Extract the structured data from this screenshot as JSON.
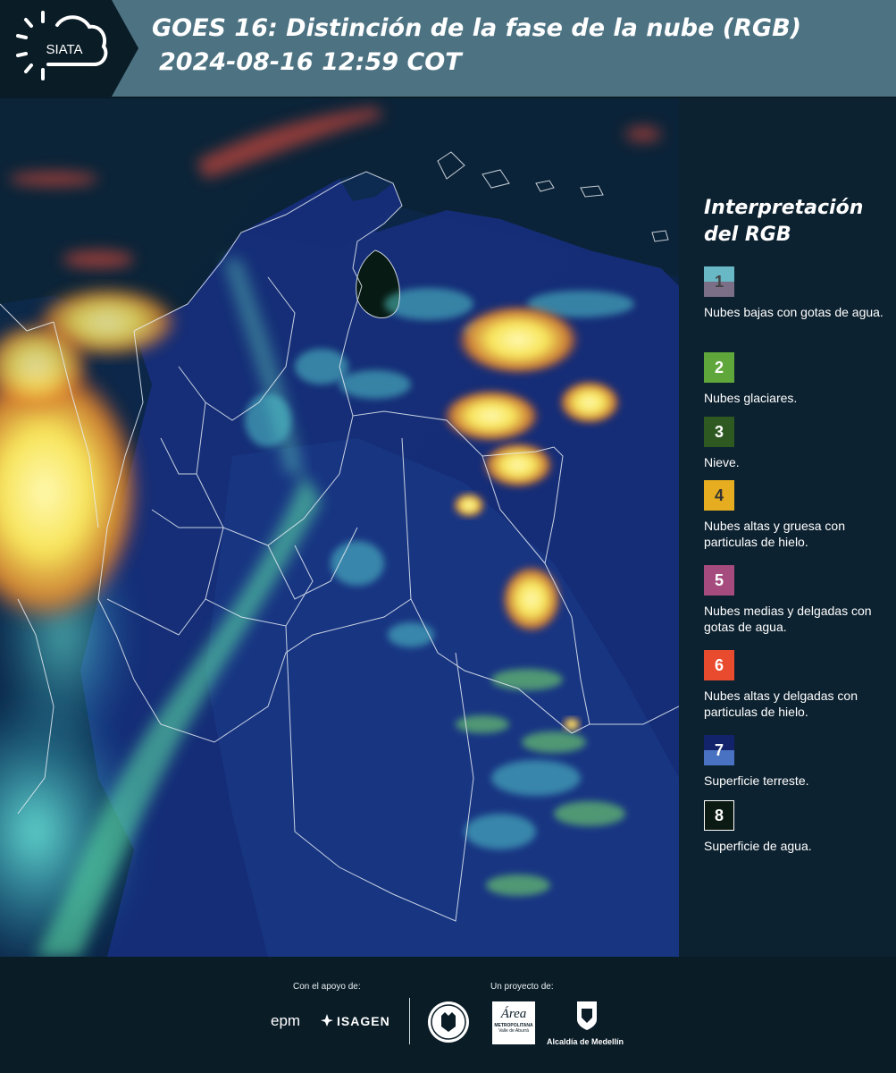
{
  "header": {
    "logo_text": "SIATA",
    "title_line1": "GOES 16: Distinción de la fase de la nube (RGB)",
    "title_line2": "2024-08-16 12:59 COT"
  },
  "legend": {
    "title": "Interpretación del RGB",
    "items": [
      {
        "number": "1",
        "label": "Nubes bajas con gotas de agua.",
        "color_top": "#68b8c6",
        "color_bottom": "#7a6f86",
        "text_color": "#444444"
      },
      {
        "number": "2",
        "label": "Nubes glaciares.",
        "color_top": "#5fa73a",
        "color_bottom": "#5fa73a",
        "text_color": "#ffffff"
      },
      {
        "number": "3",
        "label": "Nieve.",
        "color_top": "#2e5a22",
        "color_bottom": "#2e5a22",
        "text_color": "#ffffff"
      },
      {
        "number": "4",
        "label": "Nubes altas y gruesa con particulas de hielo.",
        "color_top": "#e5ad1f",
        "color_bottom": "#e5ad1f",
        "text_color": "#333333"
      },
      {
        "number": "5",
        "label": "Nubes medias y delgadas con gotas de agua.",
        "color_top": "#a54b7e",
        "color_bottom": "#a54b7e",
        "text_color": "#ffffff"
      },
      {
        "number": "6",
        "label": "Nubes altas y delgadas con particulas de hielo.",
        "color_top": "#e94b2f",
        "color_bottom": "#e94b2f",
        "text_color": "#ffffff"
      },
      {
        "number": "7",
        "label": "Superficie terreste.",
        "color_top": "#13236b",
        "color_bottom": "#4a72c2",
        "text_color": "#ffffff"
      },
      {
        "number": "8",
        "label": "Superficie de agua.",
        "color_top": "#0b1a12",
        "color_bottom": "#0b1a12",
        "text_color": "#ffffff"
      }
    ]
  },
  "footer": {
    "support_label": "Con el apoyo de:",
    "project_label": "Un proyecto de:",
    "epm": "epm",
    "isagen": "ISAGEN",
    "area_line1": "Área",
    "area_line2": "METROPOLITANA",
    "area_line3": "Valle de Aburrá",
    "alcaldia": "Alcaldía de Medellín"
  }
}
